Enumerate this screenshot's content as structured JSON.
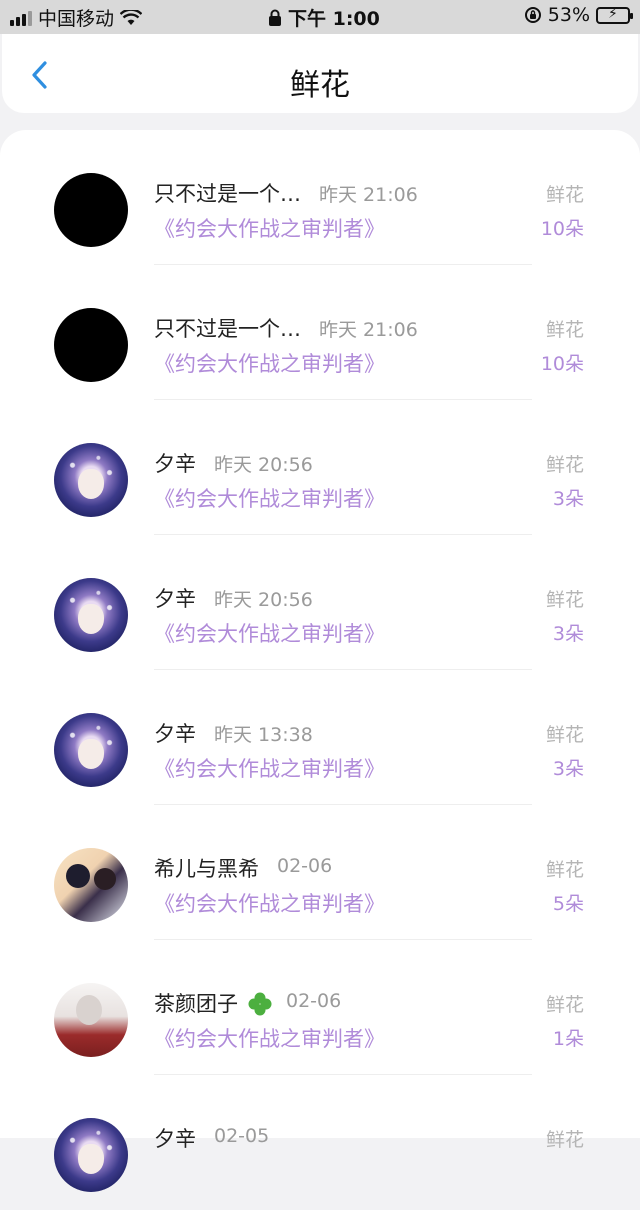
{
  "status_bar": {
    "carrier": "中国移动",
    "time": "下午 1:00",
    "battery": "53%",
    "battery_level": 0.53
  },
  "nav": {
    "title": "鲜花"
  },
  "colors": {
    "accent_purple": "#b08bd9",
    "back_blue": "#2f8fe0"
  },
  "rows": [
    {
      "name": "只不过是一个…",
      "time": "昨天 21:06",
      "gift": "《约会大作战之审判者》",
      "kind": "鲜花",
      "count": "10朵",
      "avatar": "black"
    },
    {
      "name": "只不过是一个…",
      "time": "昨天 21:06",
      "gift": "《约会大作战之审判者》",
      "kind": "鲜花",
      "count": "10朵",
      "avatar": "black"
    },
    {
      "name": "夕辛",
      "time": "昨天 20:56",
      "gift": "《约会大作战之审判者》",
      "kind": "鲜花",
      "count": "3朵",
      "avatar": "anime"
    },
    {
      "name": "夕辛",
      "time": "昨天 20:56",
      "gift": "《约会大作战之审判者》",
      "kind": "鲜花",
      "count": "3朵",
      "avatar": "anime"
    },
    {
      "name": "夕辛",
      "time": "昨天 13:38",
      "gift": "《约会大作战之审判者》",
      "kind": "鲜花",
      "count": "3朵",
      "avatar": "anime"
    },
    {
      "name": "希儿与黑希",
      "time": "02-06",
      "gift": "《约会大作战之审判者》",
      "kind": "鲜花",
      "count": "5朵",
      "avatar": "pair"
    },
    {
      "name": "茶颜团子",
      "time": "02-06",
      "gift": "《约会大作战之审判者》",
      "kind": "鲜花",
      "count": "1朵",
      "avatar": "red"
    },
    {
      "name": "夕辛",
      "time": "02-05",
      "gift": "",
      "kind": "鲜花",
      "count": "",
      "avatar": "anime"
    }
  ]
}
